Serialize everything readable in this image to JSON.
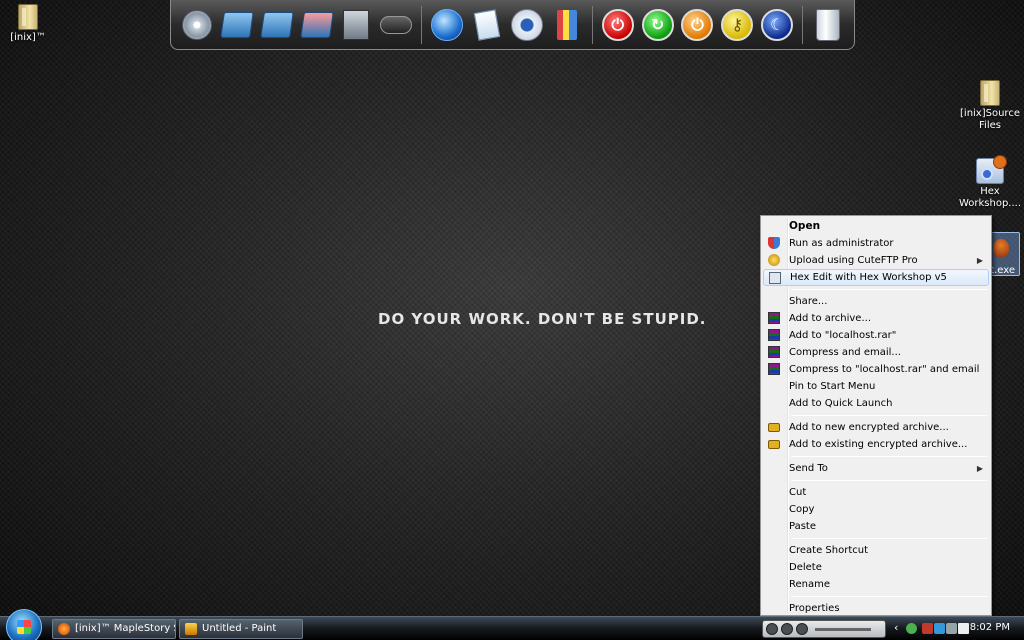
{
  "desktop": {
    "slogan": "DO YOUR WORK. DON'T BE STUPID.",
    "icons": [
      {
        "label": "[inix]™"
      },
      {
        "label": "[inix]Source Files"
      },
      {
        "label": "Hex Workshop...."
      },
      {
        "label": "st.exe"
      }
    ]
  },
  "dock": {
    "items": [
      "disc-icon",
      "folder-icon",
      "folder-network-icon",
      "pictures-folder-icon",
      "film-icon",
      "gamepad-icon",
      "browser-globe-icon",
      "document-icon",
      "music-icon",
      "paint-brushes-icon",
      "shutdown-icon",
      "restart-icon",
      "logoff-icon",
      "lock-key-icon",
      "sleep-icon",
      "recycle-bin-icon"
    ]
  },
  "context_menu": {
    "items": [
      {
        "label": "Open",
        "bold": true
      },
      {
        "label": "Run as administrator",
        "icon": "shield-icon"
      },
      {
        "label": "Upload using CuteFTP Pro",
        "icon": "cuteftp-icon",
        "submenu": true
      },
      {
        "label": "Hex Edit with Hex Workshop v5",
        "icon": "hex-workshop-icon",
        "highlighted": true
      },
      {
        "label": "Share..."
      },
      {
        "label": "Add to archive...",
        "icon": "winrar-icon"
      },
      {
        "label": "Add to \"localhost.rar\"",
        "icon": "winrar-icon"
      },
      {
        "label": "Compress and email...",
        "icon": "winrar-icon"
      },
      {
        "label": "Compress to \"localhost.rar\" and email",
        "icon": "winrar-icon"
      },
      {
        "label": "Pin to Start Menu"
      },
      {
        "label": "Add to Quick Launch"
      },
      {
        "label": "Add to new encrypted archive...",
        "icon": "lock-icon"
      },
      {
        "label": "Add to existing encrypted archive...",
        "icon": "lock-icon"
      },
      {
        "label": "Send To",
        "submenu": true
      },
      {
        "label": "Cut"
      },
      {
        "label": "Copy"
      },
      {
        "label": "Paste"
      },
      {
        "label": "Create Shortcut"
      },
      {
        "label": "Delete"
      },
      {
        "label": "Rename"
      },
      {
        "label": "Properties"
      }
    ],
    "submenu_arrow": "▶"
  },
  "taskbar": {
    "buttons": [
      {
        "label": "[inix]™ MapleStory S..."
      },
      {
        "label": "Untitled - Paint"
      }
    ],
    "clock": "8:02 PM",
    "tray_expand": "‹"
  }
}
